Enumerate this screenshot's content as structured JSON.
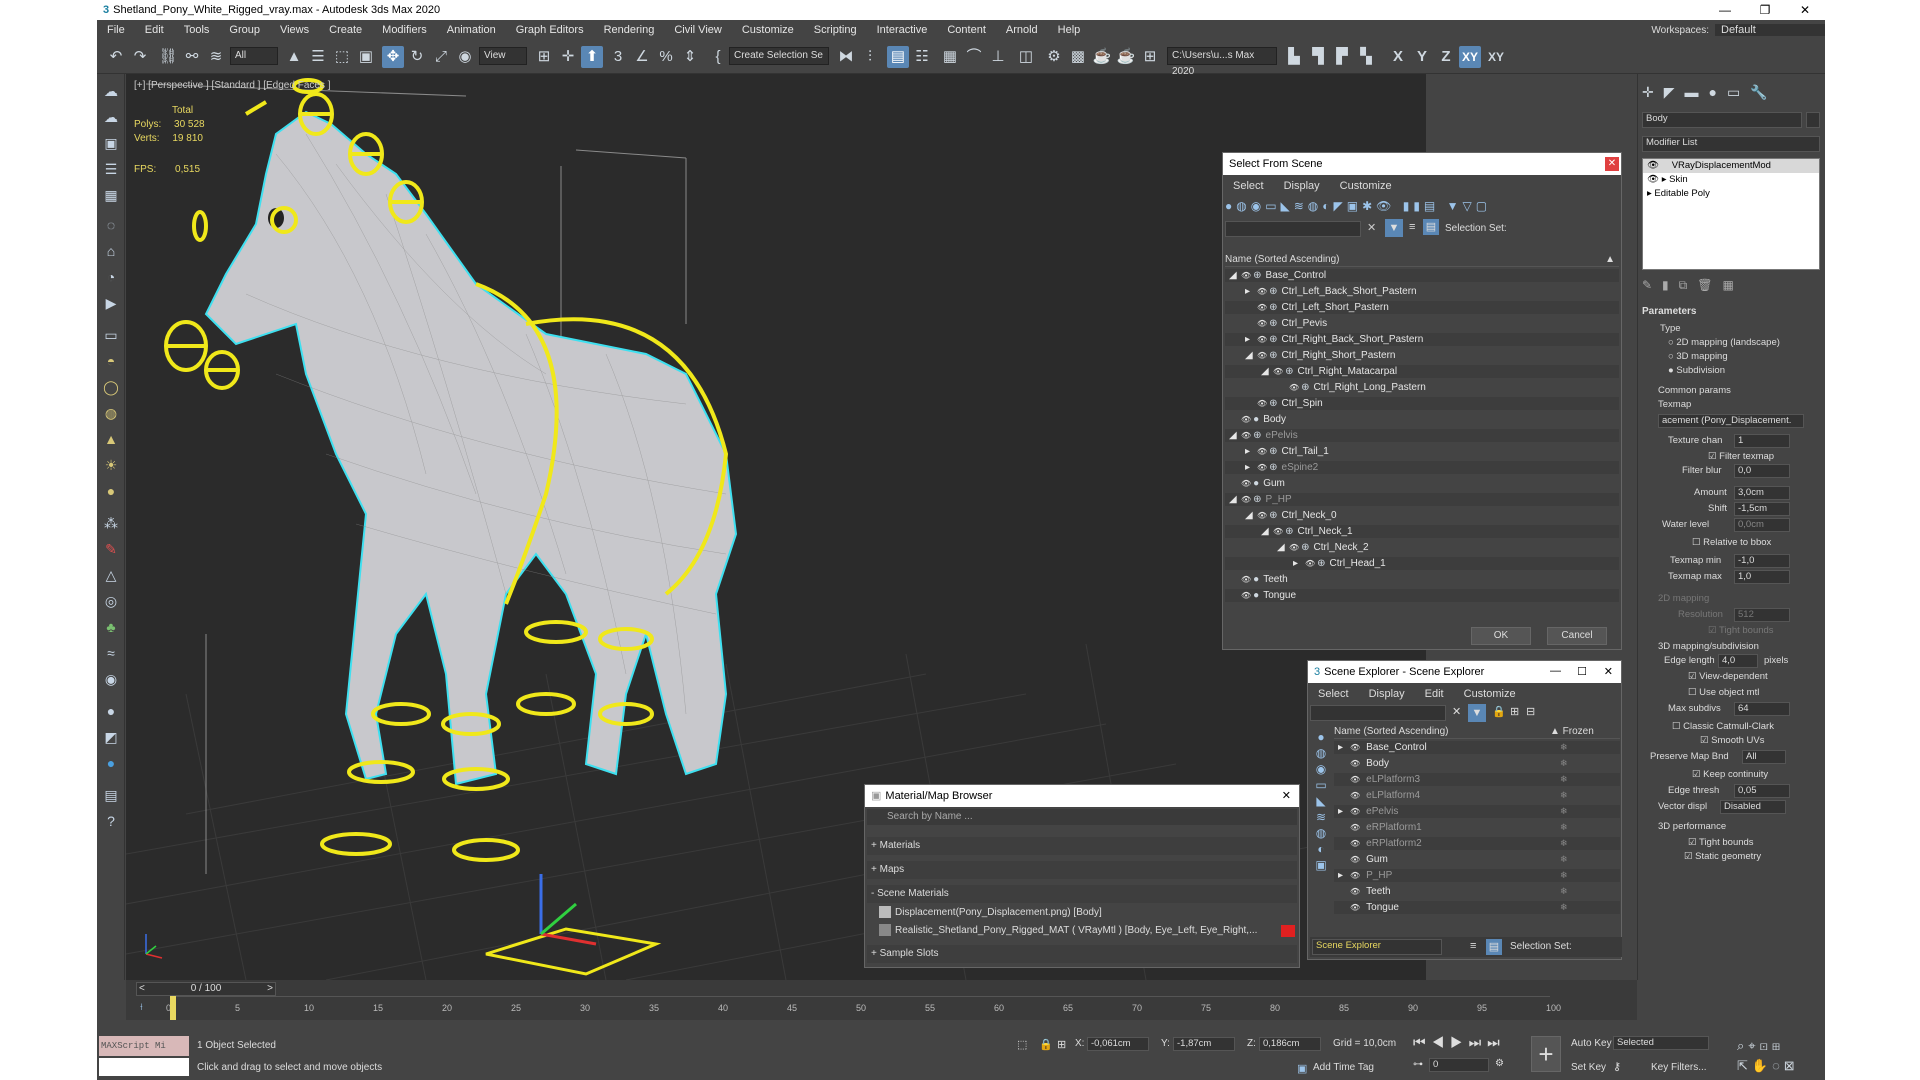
{
  "title": "Shetland_Pony_White_Rigged_vray.max - Autodesk 3ds Max 2020",
  "window_buttons": [
    "—",
    "❐",
    "✕"
  ],
  "menu": [
    "File",
    "Edit",
    "Tools",
    "Group",
    "Views",
    "Create",
    "Modifiers",
    "Animation",
    "Graph Editors",
    "Rendering",
    "Civil View",
    "Customize",
    "Scripting",
    "Interactive",
    "Content",
    "Arnold",
    "Help"
  ],
  "workspace": {
    "label": "Workspaces:",
    "value": "Default"
  },
  "toolbar": {
    "filter_value": "All",
    "view_value": "View",
    "selection_set": "Create Selection Se",
    "path": "C:\\Users\\u...s Max 2020",
    "axis_x": "X",
    "axis_y": "Y",
    "axis_z": "Z",
    "axis_xy": "XY",
    "axis_xyp": "XY"
  },
  "viewport": {
    "label": "[+] [Perspective ] [Standard ] [Edged Faces ]",
    "stats": {
      "total_label": "Total",
      "polys_label": "Polys:",
      "polys_value": "30 528",
      "verts_label": "Verts:",
      "verts_value": "19 810"
    },
    "fps_label": "FPS:",
    "fps_value": "0,515"
  },
  "select_from_scene": {
    "title": "Select From Scene",
    "menu": [
      "Select",
      "Display",
      "Customize"
    ],
    "selection_set_label": "Selection Set:",
    "column": "Name (Sorted Ascending)",
    "rows": [
      {
        "name": "Base_Control",
        "indent": 0
      },
      {
        "name": "Ctrl_Left_Back_Short_Pastern",
        "indent": 1
      },
      {
        "name": "Ctrl_Left_Short_Pastern",
        "indent": 1
      },
      {
        "name": "Ctrl_Pevis",
        "indent": 1
      },
      {
        "name": "Ctrl_Right_Back_Short_Pastern",
        "indent": 1
      },
      {
        "name": "Ctrl_Right_Short_Pastern",
        "indent": 1
      },
      {
        "name": "Ctrl_Right_Matacarpal",
        "indent": 2
      },
      {
        "name": "Ctrl_Right_Long_Pastern",
        "indent": 3
      },
      {
        "name": "Ctrl_Spin",
        "indent": 1
      },
      {
        "name": "Body",
        "indent": 0
      },
      {
        "name": "ePelvis",
        "indent": 0
      },
      {
        "name": "Ctrl_Tail_1",
        "indent": 1
      },
      {
        "name": "eSpine2",
        "indent": 1
      },
      {
        "name": "Gum",
        "indent": 0
      },
      {
        "name": "P_HP",
        "indent": 0
      },
      {
        "name": "Ctrl_Neck_0",
        "indent": 1
      },
      {
        "name": "Ctrl_Neck_1",
        "indent": 2
      },
      {
        "name": "Ctrl_Neck_2",
        "indent": 3
      },
      {
        "name": "Ctrl_Head_1",
        "indent": 4
      },
      {
        "name": "Teeth",
        "indent": 0
      },
      {
        "name": "Tongue",
        "indent": 0
      }
    ],
    "ok": "OK",
    "cancel": "Cancel"
  },
  "scene_explorer": {
    "title": "Scene Explorer - Scene Explorer",
    "menu": [
      "Select",
      "Display",
      "Edit",
      "Customize"
    ],
    "col_name": "Name (Sorted Ascending)",
    "col_frozen": "▲ Frozen",
    "rows": [
      "Base_Control",
      "Body",
      "eLPlatform3",
      "eLPlatform4",
      "ePelvis",
      "eRPlatform1",
      "eRPlatform2",
      "Gum",
      "P_HP",
      "Teeth",
      "Tongue"
    ],
    "footer_name": "Scene Explorer",
    "selection_set_label": "Selection Set:"
  },
  "material_browser": {
    "title": "Material/Map Browser",
    "search_placeholder": "Search by Name ...",
    "sections": [
      "+ Materials",
      "+ Maps",
      "- Scene Materials"
    ],
    "items": [
      "Displacement(Pony_Displacement.png) [Body]",
      "Realistic_Shetland_Pony_Rigged_MAT ( VRayMtl ) [Body, Eye_Left, Eye_Right,..."
    ],
    "sample_slots": "+ Sample Slots"
  },
  "command_panel": {
    "object_name": "Body",
    "modifier_list": "Modifier List",
    "stack": [
      "VRayDisplacementMod",
      "Skin",
      "Editable Poly"
    ],
    "parameters": "Parameters",
    "type_label": "Type",
    "type_options": [
      "2D mapping (landscape)",
      "3D mapping",
      "Subdivision"
    ],
    "common_params": "Common params",
    "texmap_label": "Texmap",
    "texmap_value": "acement (Pony_Displacement.",
    "texture_chan_label": "Texture chan",
    "texture_chan_value": "1",
    "filter_texmap": "Filter texmap",
    "filter_blur_label": "Filter blur",
    "filter_blur_value": "0,0",
    "amount_label": "Amount",
    "amount_value": "3,0cm",
    "shift_label": "Shift",
    "shift_value": "-1,5cm",
    "water_level_label": "Water level",
    "water_level_value": "0,0cm",
    "relative_bbox": "Relative to bbox",
    "texmap_min_label": "Texmap min",
    "texmap_min_value": "-1,0",
    "texmap_max_label": "Texmap max",
    "texmap_max_value": "1,0",
    "mapping_2d": "2D mapping",
    "resolution_label": "Resolution",
    "resolution_value": "512",
    "tight_bounds": "Tight bounds",
    "mapping_3d": "3D mapping/subdivision",
    "edge_length_label": "Edge length",
    "edge_length_value": "4,0",
    "edge_length_unit": "pixels",
    "view_dependent": "View-dependent",
    "use_object_mtl": "Use object mtl",
    "max_subdivs_label": "Max subdivs",
    "max_subdivs_value": "64",
    "classic_cc": "Classic Catmull-Clark",
    "smooth_uvs": "Smooth UVs",
    "preserve_map_label": "Preserve Map Bnd",
    "preserve_map_value": "All",
    "keep_continuity": "Keep continuity",
    "edge_thresh_label": "Edge thresh",
    "edge_thresh_value": "0,05",
    "vector_disp_label": "Vector displ",
    "vector_disp_value": "Disabled",
    "perf_3d": "3D performance",
    "tight_bounds2": "Tight bounds",
    "static_geometry": "Static geometry"
  },
  "timeline": {
    "frame": "0 / 100",
    "ticks": [
      "0",
      "5",
      "10",
      "15",
      "20",
      "25",
      "30",
      "35",
      "40",
      "45",
      "50",
      "55",
      "60",
      "65",
      "70",
      "75",
      "80",
      "85",
      "90",
      "95",
      "100"
    ]
  },
  "status": {
    "maxscript": "MAXScript Mi",
    "selected": "1 Object Selected",
    "hint": "Click and drag to select and move objects",
    "x_label": "X:",
    "x_value": "-0,061cm",
    "y_label": "Y:",
    "y_value": "-1,87cm",
    "z_label": "Z:",
    "z_value": "0,186cm",
    "grid": "Grid = 10,0cm",
    "add_time_tag": "Add Time Tag",
    "auto_key": "Auto Key",
    "set_key": "Set Key",
    "selected_dd": "Selected",
    "key_filters": "Key Filters...",
    "frame_value": "0"
  },
  "colors": {
    "accent": "#5a87b5",
    "rig_yellow": "#f0e81a",
    "wire_cyan": "#3ee0f0"
  }
}
